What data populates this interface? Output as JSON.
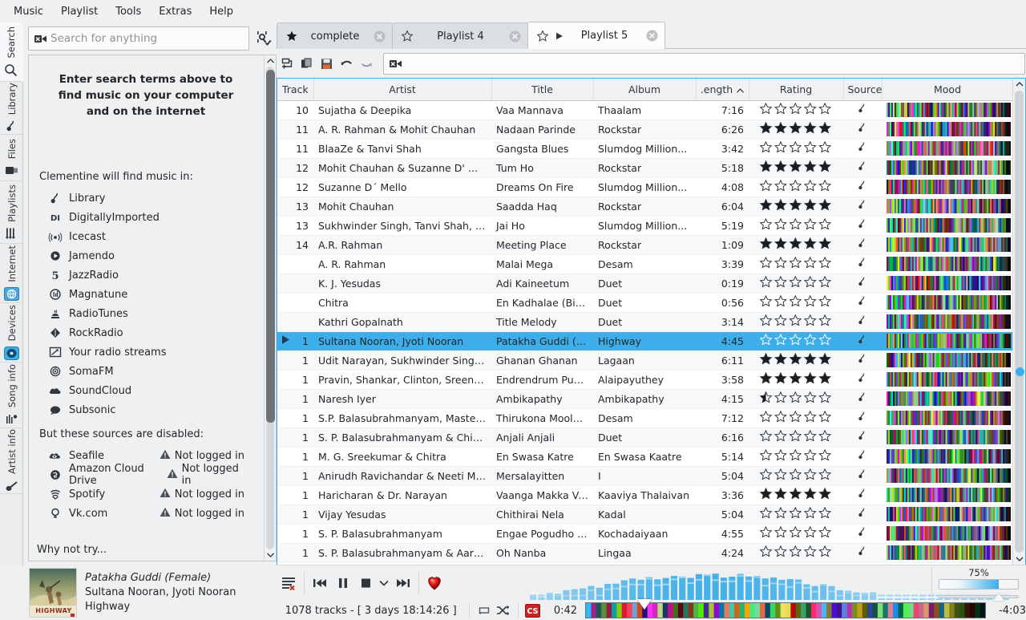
{
  "menubar": {
    "items": [
      "Music",
      "Playlist",
      "Tools",
      "Extras",
      "Help"
    ]
  },
  "rail": {
    "tabs": [
      {
        "label": "Search",
        "icon": "magnifier-icon",
        "active": true
      },
      {
        "label": "Library",
        "icon": "music-note-icon",
        "active": false
      },
      {
        "label": "Files",
        "icon": "folder-icon",
        "active": false
      },
      {
        "label": "Playlists",
        "icon": "playlists-icon",
        "active": false
      },
      {
        "label": "Internet",
        "icon": "internet-globe-icon",
        "active": false
      },
      {
        "label": "Devices",
        "icon": "device-disc-icon",
        "active": false
      },
      {
        "label": "Song info",
        "icon": "song-info-icon",
        "active": false
      },
      {
        "label": "Artist info",
        "icon": "artist-info-icon",
        "active": false
      }
    ]
  },
  "search": {
    "placeholder": "Search for anything",
    "value": "",
    "clear_icon": "clear-icon",
    "settings_icon": "search-settings-icon",
    "hint": "Enter search terms above to find music on your computer and on the internet",
    "sources_title": "Clementine will find music in:",
    "sources": [
      {
        "name": "Library",
        "icon": "music-note-icon"
      },
      {
        "name": "DigitallyImported",
        "icon": "di-icon"
      },
      {
        "name": "Icecast",
        "icon": "broadcast-icon"
      },
      {
        "name": "Jamendo",
        "icon": "play-circle-icon"
      },
      {
        "name": "JazzRadio",
        "icon": "jazzradio-icon"
      },
      {
        "name": "Magnatune",
        "icon": "magnatune-icon"
      },
      {
        "name": "RadioTunes",
        "icon": "radiotunes-icon"
      },
      {
        "name": "RockRadio",
        "icon": "rockradio-icon"
      },
      {
        "name": "Your radio streams",
        "icon": "radio-stream-icon"
      },
      {
        "name": "SomaFM",
        "icon": "somafm-icon"
      },
      {
        "name": "SoundCloud",
        "icon": "cloud-icon"
      },
      {
        "name": "Subsonic",
        "icon": "subsonic-icon"
      }
    ],
    "disabled_title": "But these sources are disabled:",
    "disabled_sources": [
      {
        "name": "Seafile",
        "icon": "seafile-icon",
        "status": "Not logged in",
        "status_icon": "warning-icon"
      },
      {
        "name": "Amazon Cloud Drive",
        "icon": "amazon-icon",
        "status": "Not logged in",
        "status_icon": "warning-icon"
      },
      {
        "name": "Spotify",
        "icon": "spotify-icon",
        "status": "Not logged in",
        "status_icon": "warning-icon"
      },
      {
        "name": "Vk.com",
        "icon": "vk-icon",
        "status": "Not logged in",
        "status_icon": "warning-icon"
      }
    ],
    "why_not_try": "Why not try..."
  },
  "playlist_tabs": [
    {
      "label": "complete",
      "starred": true,
      "playing": false,
      "active": false
    },
    {
      "label": "Playlist 4",
      "starred": false,
      "playing": false,
      "active": false
    },
    {
      "label": "Playlist 5",
      "starred": false,
      "playing": true,
      "active": true
    }
  ],
  "playlist_toolbar": {
    "buttons": [
      {
        "name": "new-playlist-button",
        "icon": "new-playlist-icon"
      },
      {
        "name": "duplicate-playlist-button",
        "icon": "duplicate-icon"
      },
      {
        "name": "save-playlist-button",
        "icon": "save-icon"
      },
      {
        "name": "undo-button",
        "icon": "undo-icon"
      },
      {
        "name": "redo-button",
        "icon": "redo-icon"
      }
    ],
    "filter_value": "",
    "filter_placeholder": ""
  },
  "table": {
    "columns": [
      "Track",
      "Artist",
      "Title",
      "Album",
      ".ength",
      "Rating",
      "Source",
      "Mood"
    ],
    "sorted_column": ".ength",
    "sort_direction": "asc",
    "rows": [
      {
        "track": "10",
        "artist": "Sujatha & Deepika",
        "title": "Vaa Mannava",
        "album": "Thaalam",
        "length": "7:16",
        "rating": 0,
        "source": "library"
      },
      {
        "track": "11",
        "artist": "A. R. Rahman & Mohit Chauhan",
        "title": "Nadaan Parinde",
        "album": "Rockstar",
        "length": "6:26",
        "rating": 5,
        "source": "library"
      },
      {
        "track": "11",
        "artist": "BlaaZe & Tanvi Shah",
        "title": "Gangsta Blues",
        "album": "Slumdog Million...",
        "length": "3:42",
        "rating": 0,
        "source": "library"
      },
      {
        "track": "12",
        "artist": "Mohit Chauhan & Suzanne D' Mello",
        "title": "Tum Ho",
        "album": "Rockstar",
        "length": "5:18",
        "rating": 5,
        "source": "library"
      },
      {
        "track": "12",
        "artist": "Suzanne D´ Mello",
        "title": "Dreams On Fire",
        "album": "Slumdog Million...",
        "length": "4:08",
        "rating": 0,
        "source": "library"
      },
      {
        "track": "13",
        "artist": "Mohit Chauhan",
        "title": "Saadda Haq",
        "album": "Rockstar",
        "length": "6:04",
        "rating": 5,
        "source": "library"
      },
      {
        "track": "13",
        "artist": "Sukhwinder Singh, Tanvi Shah, Mah...",
        "title": "Jai Ho",
        "album": "Slumdog Million...",
        "length": "5:19",
        "rating": 0,
        "source": "library"
      },
      {
        "track": "14",
        "artist": "A.R. Rahman",
        "title": "Meeting Place",
        "album": "Rockstar",
        "length": "1:09",
        "rating": 5,
        "source": "library"
      },
      {
        "track": "",
        "artist": "A. R. Rahman",
        "title": "Malai Mega",
        "album": "Desam",
        "length": "3:39",
        "rating": 0,
        "source": "library"
      },
      {
        "track": "",
        "artist": "K. J. Yesudas",
        "title": "Adi Kaineetum",
        "album": "Duet",
        "length": "0:19",
        "rating": 0,
        "source": "library"
      },
      {
        "track": "",
        "artist": "Chitra",
        "title": "En Kadhalae (Bit So...",
        "album": "Duet",
        "length": "0:56",
        "rating": 0,
        "source": "library"
      },
      {
        "track": "",
        "artist": "Kathri Gopalnath",
        "title": "Title Melody",
        "album": "Duet",
        "length": "3:14",
        "rating": 0,
        "source": "library"
      },
      {
        "track": "1",
        "artist": "Sultana Nooran, Jyoti Nooran",
        "title": "Patakha Guddi (Fe...",
        "album": "Highway",
        "length": "4:45",
        "rating": 0,
        "source": "library",
        "selected": true,
        "playing": true
      },
      {
        "track": "1",
        "artist": "Udit Narayan, Sukhwinder Singh, Al...",
        "title": "Ghanan Ghanan",
        "album": "Lagaan",
        "length": "6:11",
        "rating": 5,
        "source": "library"
      },
      {
        "track": "1",
        "artist": "Pravin, Shankar, Clinton, Sreenivas ...",
        "title": "Endrendrum Punna...",
        "album": "Alaipayuthey",
        "length": "3:58",
        "rating": 5,
        "source": "library"
      },
      {
        "track": "1",
        "artist": "Naresh Iyer",
        "title": "Ambikapathy",
        "album": "Ambikapathy",
        "length": "4:15",
        "rating": 0.5,
        "source": "library"
      },
      {
        "track": "1",
        "artist": "S.P. Balasubrahmanyam, Master Vig...",
        "title": "Thirukona Moolam",
        "album": "Desam",
        "length": "7:12",
        "rating": 0,
        "source": "library"
      },
      {
        "track": "1",
        "artist": "S. P. Balasubrahmanyam & Chitra",
        "title": "Anjali Anjali",
        "album": "Duet",
        "length": "6:16",
        "rating": 0,
        "source": "library"
      },
      {
        "track": "1",
        "artist": "M. G. Sreekumar & Chitra",
        "title": "En Swasa Katre",
        "album": "En Swasa Kaatre",
        "length": "5:14",
        "rating": 0,
        "source": "library"
      },
      {
        "track": "1",
        "artist": "Anirudh Ravichandar & Neeti Mohan",
        "title": "Mersalayitten",
        "album": "I",
        "length": "5:04",
        "rating": 0,
        "source": "library"
      },
      {
        "track": "1",
        "artist": "Haricharan & Dr. Narayan",
        "title": "Vaanga Makka Vaa...",
        "album": "Kaaviya Thalaivan",
        "length": "3:36",
        "rating": 5,
        "source": "library"
      },
      {
        "track": "1",
        "artist": "Vijay Yesudas",
        "title": "Chithirai Nela",
        "album": "Kadal",
        "length": "5:04",
        "rating": 0,
        "source": "library"
      },
      {
        "track": "1",
        "artist": "S. P. Balasubrahmanyam",
        "title": "Engae Pogudho Va...",
        "album": "Kochadaiyaan",
        "length": "4:55",
        "rating": 0,
        "source": "library"
      },
      {
        "track": "1",
        "artist": "S. P. Balasubrahmanyam & Aaryan D...",
        "title": "Oh Nanba",
        "album": "Lingaa",
        "length": "4:24",
        "rating": 0,
        "source": "library"
      }
    ]
  },
  "now_playing": {
    "title": "Patakha Guddi (Female)",
    "artist": "Sultana Nooran, Jyoti Nooran",
    "album": "Highway",
    "art_caption": "HIGHWAY"
  },
  "transport": {
    "buttons": [
      {
        "name": "playlist-mode-button",
        "icon": "playlist-clear-icon"
      },
      {
        "name": "previous-button",
        "icon": "previous-icon"
      },
      {
        "name": "pause-button",
        "icon": "pause-icon"
      },
      {
        "name": "stop-button",
        "icon": "stop-icon"
      },
      {
        "name": "stop-after-menu-button",
        "icon": "chevron-down-icon"
      },
      {
        "name": "next-button",
        "icon": "next-icon"
      },
      {
        "name": "love-button",
        "icon": "heart-icon"
      }
    ]
  },
  "status": {
    "track_count": "1078 tracks - [ 3 days 18:14:26 ]",
    "repeat_icon": "repeat-icon",
    "shuffle_icon": "shuffle-icon",
    "badge": "CS",
    "badge_color": "#cc2222",
    "time_current": "0:42",
    "time_remaining": "-4:03",
    "seek_position_pct": 14.7
  },
  "volume": {
    "percent_label": "75%",
    "value": 75
  },
  "colors": {
    "accent": "#3daee9",
    "window": "#eff0f1",
    "text": "#232629",
    "selection": "#3daee9"
  }
}
